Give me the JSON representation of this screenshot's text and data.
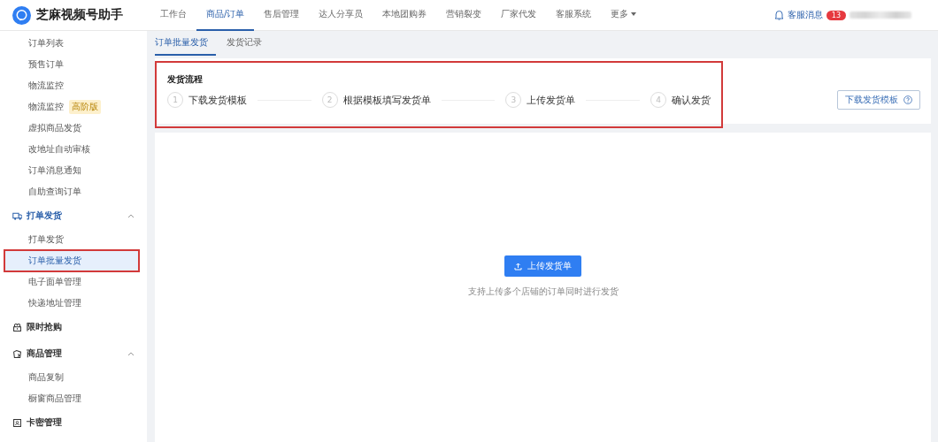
{
  "app": {
    "title": "芝麻视频号助手"
  },
  "nav": [
    {
      "label": "工作台",
      "selected": false
    },
    {
      "label": "商品/订单",
      "selected": true
    },
    {
      "label": "售后管理",
      "selected": false
    },
    {
      "label": "达人分享员",
      "selected": false
    },
    {
      "label": "本地团购券",
      "selected": false
    },
    {
      "label": "营销裂变",
      "selected": false
    },
    {
      "label": "厂家代发",
      "selected": false
    },
    {
      "label": "客服系统",
      "selected": false
    },
    {
      "label": "更多",
      "selected": false,
      "dropdown": true
    }
  ],
  "messages": {
    "label": "客服消息",
    "count": "13"
  },
  "sidebar": [
    {
      "kind": "item",
      "label": "订单列表",
      "selected": false
    },
    {
      "kind": "item",
      "label": "预售订单",
      "selected": false
    },
    {
      "kind": "item",
      "label": "物流监控",
      "selected": false
    },
    {
      "kind": "item",
      "label": "物流监控",
      "badge": "高阶版",
      "selected": false
    },
    {
      "kind": "item",
      "label": "虚拟商品发货",
      "selected": false
    },
    {
      "kind": "item",
      "label": "改地址自动审核",
      "selected": false
    },
    {
      "kind": "item",
      "label": "订单消息通知",
      "selected": false
    },
    {
      "kind": "item",
      "label": "自助查询订单",
      "selected": false
    },
    {
      "kind": "group",
      "label": "打单发货",
      "expanded": true,
      "active": true,
      "children": [
        {
          "kind": "item",
          "label": "打单发货",
          "selected": false
        },
        {
          "kind": "item",
          "label": "订单批量发货",
          "selected": true,
          "highlighted": true
        },
        {
          "kind": "item",
          "label": "电子面单管理",
          "selected": false
        },
        {
          "kind": "item",
          "label": "快递地址管理",
          "selected": false
        }
      ]
    },
    {
      "kind": "group",
      "label": "限时抢购",
      "active": false
    },
    {
      "kind": "group",
      "label": "商品管理",
      "expanded": true,
      "active": false,
      "children": [
        {
          "kind": "item",
          "label": "商品复制",
          "selected": false
        },
        {
          "kind": "item",
          "label": "橱窗商品管理",
          "selected": false
        }
      ]
    },
    {
      "kind": "group",
      "label": "卡密管理",
      "active": false
    }
  ],
  "tabs": [
    {
      "label": "订单批量发货",
      "selected": true
    },
    {
      "label": "发货记录",
      "selected": false
    }
  ],
  "process": {
    "title": "发货流程",
    "highlighted": true,
    "steps": [
      {
        "number": "1",
        "label": "下载发货模板"
      },
      {
        "number": "2",
        "label": "根据模板填写发货单"
      },
      {
        "number": "3",
        "label": "上传发货单"
      },
      {
        "number": "4",
        "label": "确认发货"
      }
    ],
    "download_button": "下载发货模板"
  },
  "upload": {
    "button": "上传发货单",
    "hint": "支持上传多个店铺的订单同时进行发货"
  }
}
